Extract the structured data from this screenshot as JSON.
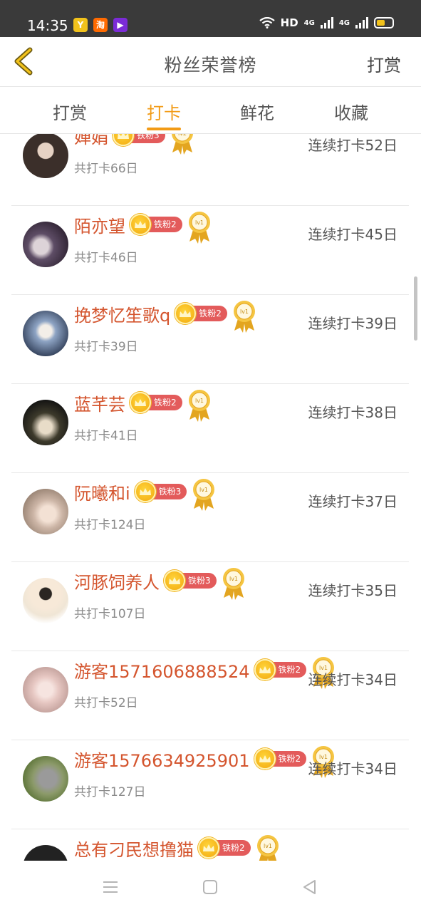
{
  "status_bar": {
    "time": "14:35",
    "apps": [
      {
        "icon": "calendar-app-icon",
        "color": "#f2c21b",
        "glyph": "Y"
      },
      {
        "icon": "taobao-app-icon",
        "color": "#ff6a00",
        "glyph": "淘"
      },
      {
        "icon": "video-app-icon",
        "color": "#7b2bd6",
        "glyph": "▶"
      }
    ],
    "network": "HD",
    "net_gen_1": "4G",
    "net_gen_2": "4G"
  },
  "header": {
    "title": "粉丝荣誉榜",
    "action_label": "打赏"
  },
  "tabs": [
    {
      "label": "打赏",
      "active": false
    },
    {
      "label": "打卡",
      "active": true
    },
    {
      "label": "鲜花",
      "active": false
    },
    {
      "label": "收藏",
      "active": false
    }
  ],
  "accent_color": "#f29b16",
  "fans": [
    {
      "name": "婵娟",
      "fan_level": "铁粉3",
      "medal": "lv2",
      "total": "共打卡66日",
      "streak": "连续打卡52日",
      "avatar_color": "#3b2f2a"
    },
    {
      "name": "陌亦望",
      "fan_level": "铁粉2",
      "medal": "lv1",
      "total": "共打卡46日",
      "streak": "连续打卡45日",
      "avatar_color": "#5e4d66"
    },
    {
      "name": "挽梦忆笙歌q",
      "fan_level": "铁粉2",
      "medal": "lv1",
      "total": "共打卡39日",
      "streak": "连续打卡39日",
      "avatar_color": "#8ea4c4"
    },
    {
      "name": "蓝芊芸",
      "fan_level": "铁粉2",
      "medal": "lv1",
      "total": "共打卡41日",
      "streak": "连续打卡38日",
      "avatar_color": "#3d3a2b"
    },
    {
      "name": "阮曦和i",
      "fan_level": "铁粉3",
      "medal": "lv1",
      "total": "共打卡124日",
      "streak": "连续打卡37日",
      "avatar_color": "#cdb6a7"
    },
    {
      "name": "河豚饲养人",
      "fan_level": "铁粉3",
      "medal": "lv1",
      "total": "共打卡107日",
      "streak": "连续打卡35日",
      "avatar_color": "#f0e6d6"
    },
    {
      "name": "游客1571606888524",
      "fan_level": "铁粉2",
      "medal": "lv1",
      "total": "共打卡52日",
      "streak": "连续打卡34日",
      "avatar_color": "#e7c8c3"
    },
    {
      "name": "游客1576634925901",
      "fan_level": "铁粉2",
      "medal": "lv1",
      "total": "共打卡127日",
      "streak": "连续打卡34日",
      "avatar_color": "#8c9a6a"
    },
    {
      "name": "总有刁民想撸猫",
      "fan_level": "铁粉2",
      "medal": "lv1",
      "total": "",
      "streak": "",
      "avatar_color": "#222222"
    }
  ],
  "nav_bar": {
    "menu_icon": "menu-icon",
    "home_icon": "home-square-icon",
    "back_icon": "back-triangle-icon"
  }
}
